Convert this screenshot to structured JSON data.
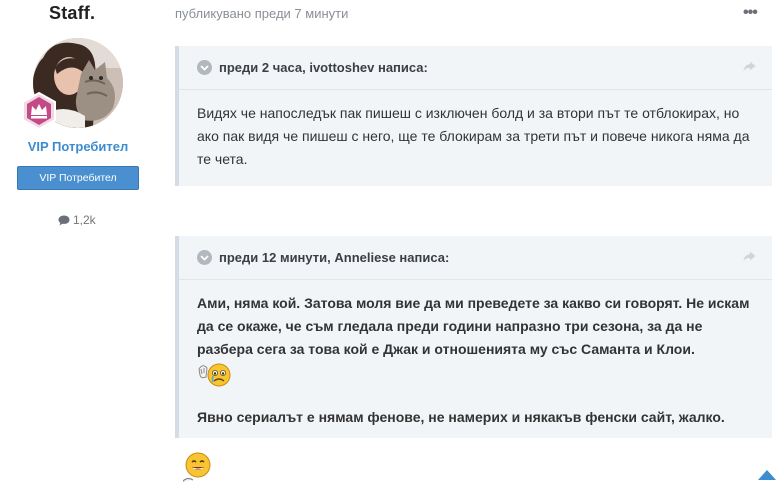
{
  "author": {
    "name": "Staff.",
    "group_name": "VIP Потребител",
    "group_badge": "VIP Потребител",
    "post_count": "1,2k",
    "accent_color": "#3d8ccf"
  },
  "post": {
    "meta": "публикувано преди 7 минути",
    "menu_label": "•••"
  },
  "quotes": [
    {
      "citation": "преди 2 часа, ivottoshev написа:",
      "paragraphs": [
        "Видях че напоследък пак пишеш с изключен болд и за втори път те отблокирах, но ако пак видя че пишеш с него, ще те блокирам за трети път и повече никога няма да те чета."
      ]
    },
    {
      "citation": "преди 12 минути, Anneliese написа:",
      "paragraphs": [
        "Ами, няма кой. Затова моля вие да ми преведете  за какво си говорят. Не искам да се окаже, че съм гледала преди години напразно три сезона, за да не разбера сега за това кой е Джак и отношенията му със Саманта и Клои.",
        "Явно сериалът е нямам фенове, не намерих и някакъв фенски сайт, жалко."
      ]
    }
  ],
  "icons": {
    "rank": "crown-rank-icon",
    "comment": "speech-bubble-icon",
    "toggle": "chevron-down-icon",
    "share": "share-icon",
    "emoji_1": "crying-emoji-icon",
    "emoji_2": "smiling-emoji-icon",
    "scroll": "scroll-to-top-icon"
  }
}
